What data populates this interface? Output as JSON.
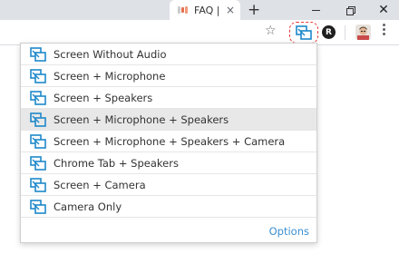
{
  "browser": {
    "tab": {
      "title": "FAQ |",
      "close": "×"
    },
    "new_tab": "+",
    "window": {
      "minimize": "",
      "maximize": "",
      "close": "✕"
    },
    "toolbar": {
      "star": "☆",
      "rec_letter": "R"
    }
  },
  "popup": {
    "accent_color": "#1e88c9",
    "items": [
      {
        "label": "Screen Without Audio",
        "selected": false
      },
      {
        "label": "Screen + Microphone",
        "selected": false
      },
      {
        "label": "Screen + Speakers",
        "selected": false
      },
      {
        "label": "Screen + Microphone + Speakers",
        "selected": true
      },
      {
        "label": "Screen + Microphone + Speakers + Camera",
        "selected": false
      },
      {
        "label": "Chrome Tab + Speakers",
        "selected": false
      },
      {
        "label": "Screen + Camera",
        "selected": false
      },
      {
        "label": "Camera Only",
        "selected": false
      }
    ],
    "options_label": "Options"
  }
}
